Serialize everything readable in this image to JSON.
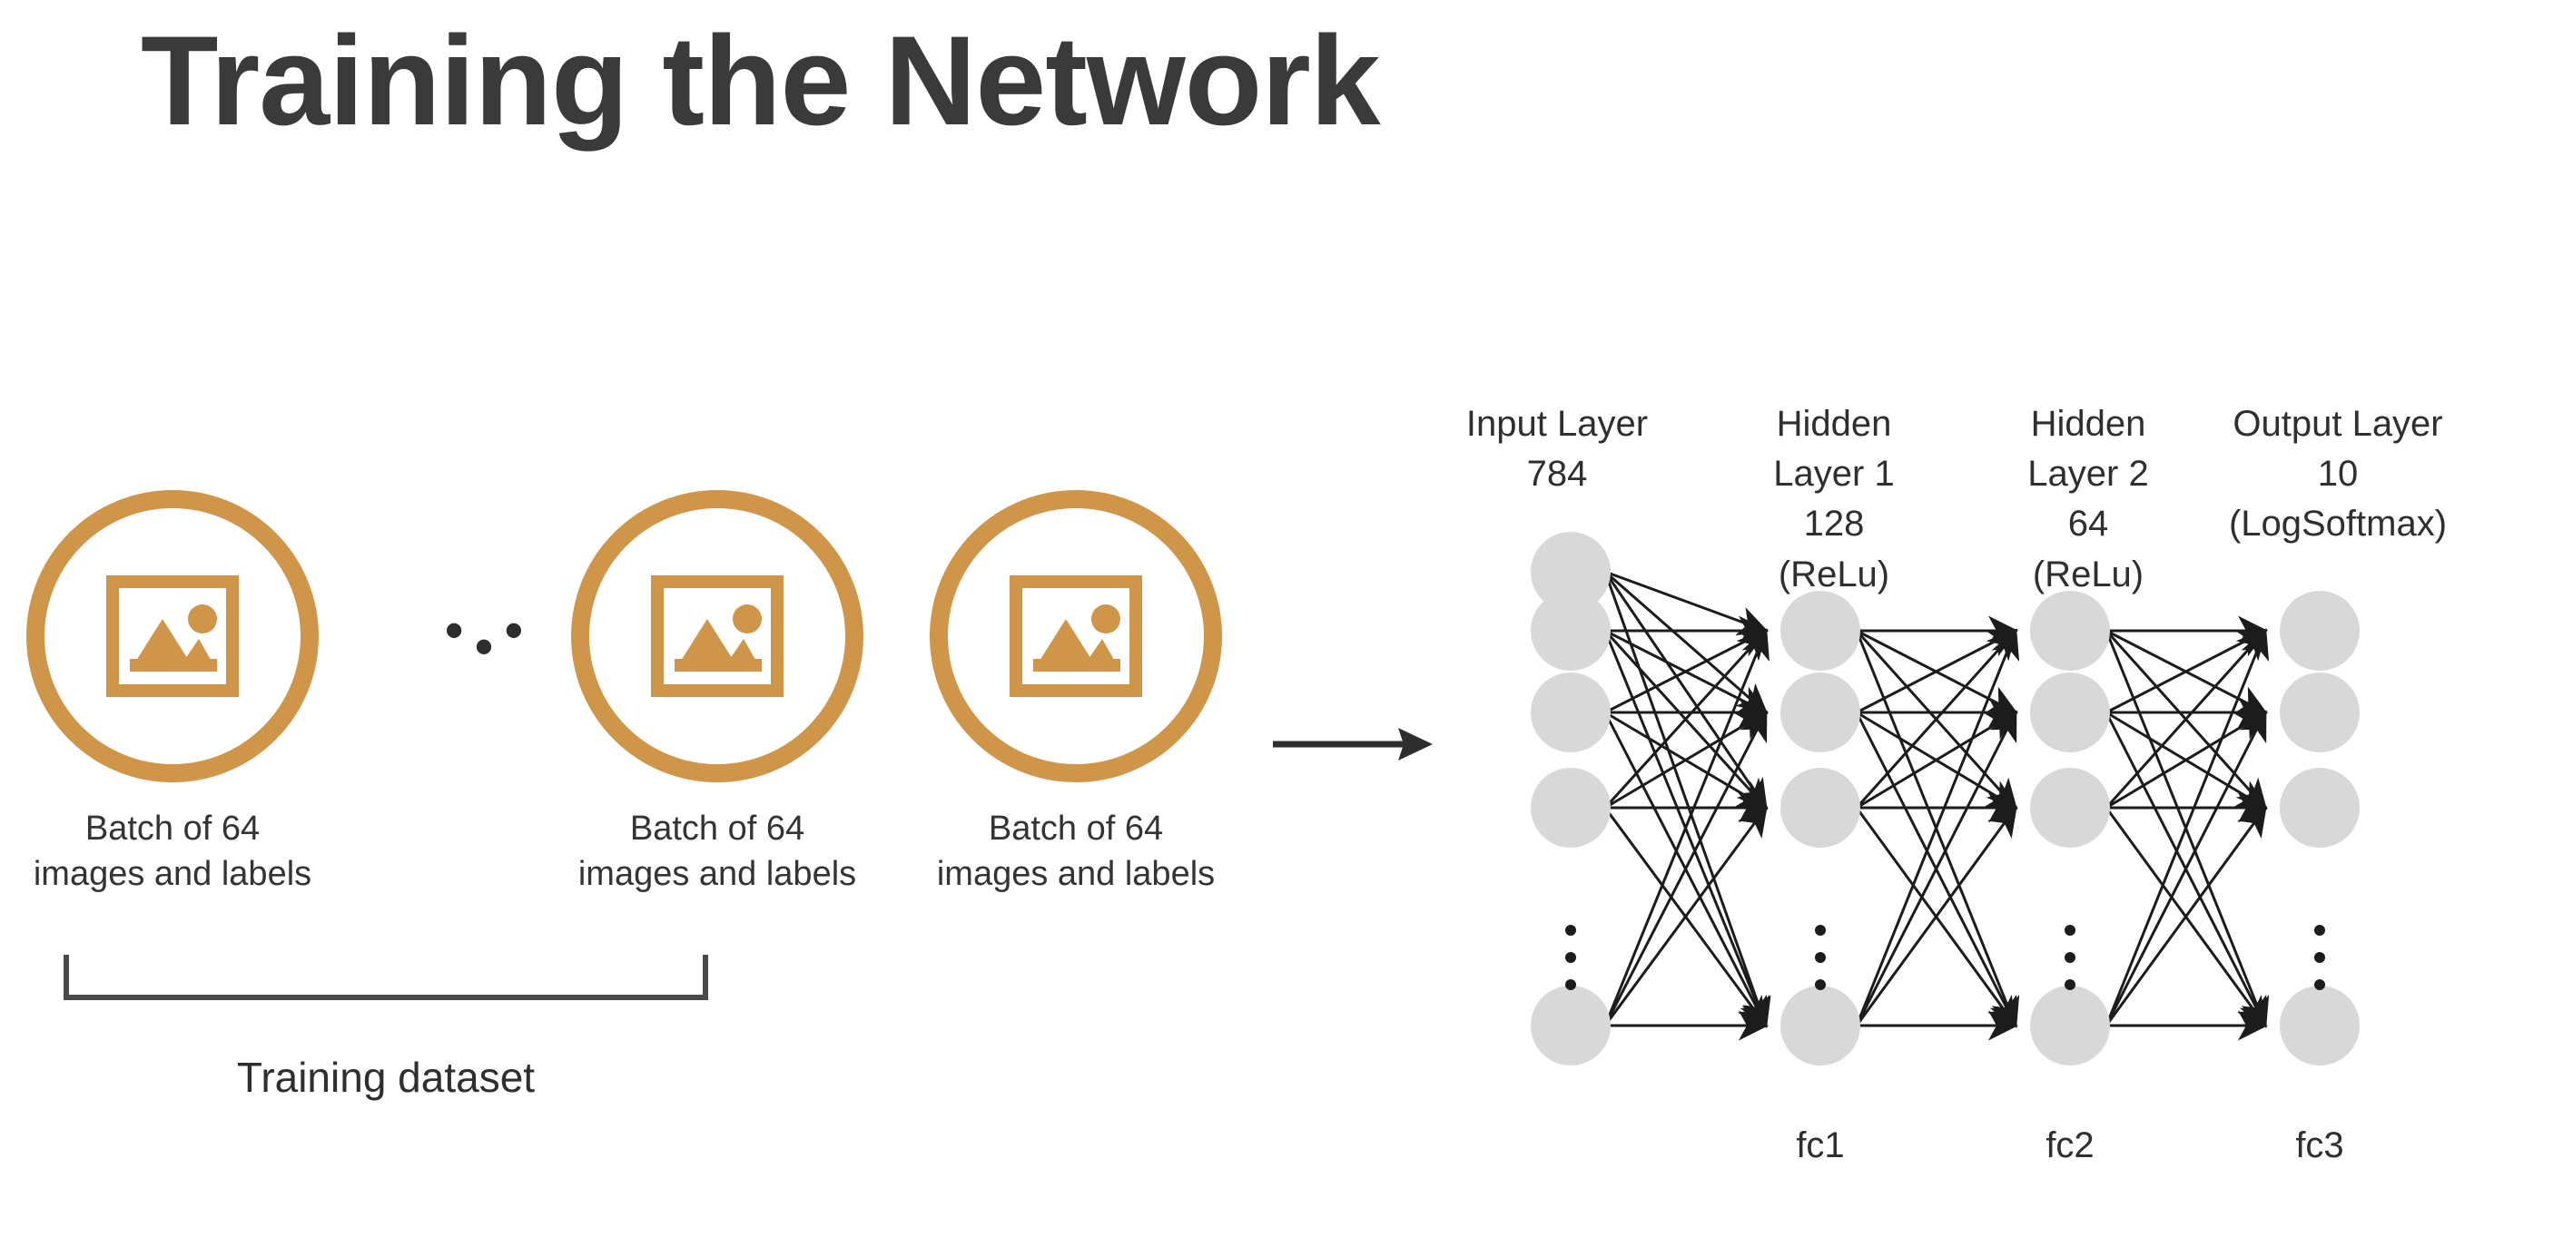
{
  "slide": {
    "title": "Training the Network",
    "background_color": "#ffffff",
    "accent_color": "#cf9549",
    "text_color": "#343434",
    "node_color": "#d8d8d9"
  },
  "dataset": {
    "ellipsis": "• • •",
    "bracket_label": "Training dataset",
    "batches": [
      {
        "icon": "image-icon",
        "caption": "Batch of 64\nimages and labels"
      },
      {
        "icon": "image-icon",
        "caption": "Batch of 64\nimages and labels"
      },
      {
        "icon": "image-icon",
        "caption": "Batch of 64\nimages and labels"
      }
    ]
  },
  "flow": {
    "arrow": "right-arrow-icon"
  },
  "network": {
    "vertical_ellipsis": "⋮",
    "layers": [
      {
        "name": "input",
        "label": "Input Layer\n784",
        "nodes_drawn": 5,
        "units": 784,
        "activation": ""
      },
      {
        "name": "hidden1",
        "label": "Hidden\nLayer 1\n128\n(ReLu)",
        "nodes_drawn": 4,
        "units": 128,
        "activation": "ReLu"
      },
      {
        "name": "hidden2",
        "label": "Hidden\nLayer 2\n64\n(ReLu)",
        "nodes_drawn": 4,
        "units": 64,
        "activation": "ReLu"
      },
      {
        "name": "output",
        "label": "Output Layer\n10\n(LogSoftmax)",
        "nodes_drawn": 4,
        "units": 10,
        "activation": "LogSoftmax"
      }
    ],
    "connections": [
      {
        "label": "fc1",
        "from": "input",
        "to": "hidden1"
      },
      {
        "label": "fc2",
        "from": "hidden1",
        "to": "hidden2"
      },
      {
        "label": "fc3",
        "from": "hidden2",
        "to": "output"
      }
    ]
  }
}
